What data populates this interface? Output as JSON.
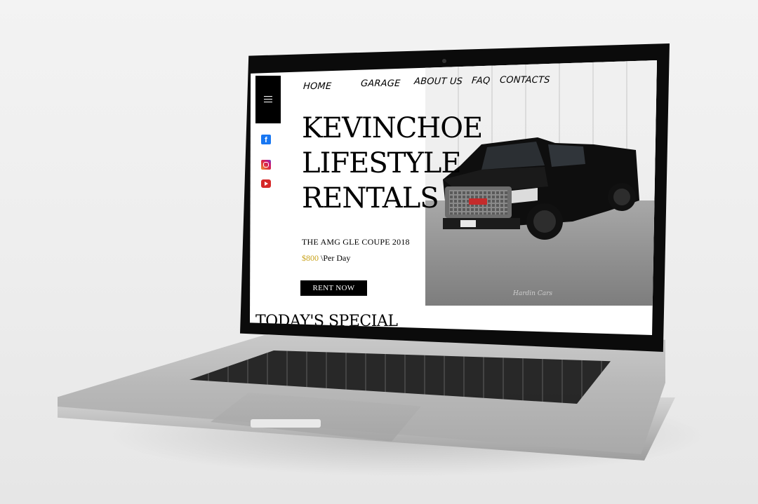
{
  "nav": {
    "home": "HOME",
    "garage": "GARAGE",
    "about": "ABOUT US",
    "faq": "FAQ",
    "contacts": "CONTACTS"
  },
  "sidebar": {
    "menu_icon": "hamburger-icon",
    "social_icons": [
      "facebook-icon",
      "instagram-icon",
      "youtube-icon"
    ],
    "facebook_glyph": "f"
  },
  "hero": {
    "title_lines": [
      "KEVINCHOE",
      "LIFESTYLE",
      "RENTALS"
    ],
    "model": "THE AMG  GLE COUPE 2018",
    "price_amount": "$800",
    "price_unit": "\\Per Day",
    "cta_label": "RENT NOW",
    "photo_watermark": "Hardin Cars"
  },
  "sections": {
    "special_heading": "TODAY'S SPECIAL"
  },
  "colors": {
    "accent_gold": "#c8a21a",
    "text": "#000000",
    "background": "#ffffff"
  }
}
